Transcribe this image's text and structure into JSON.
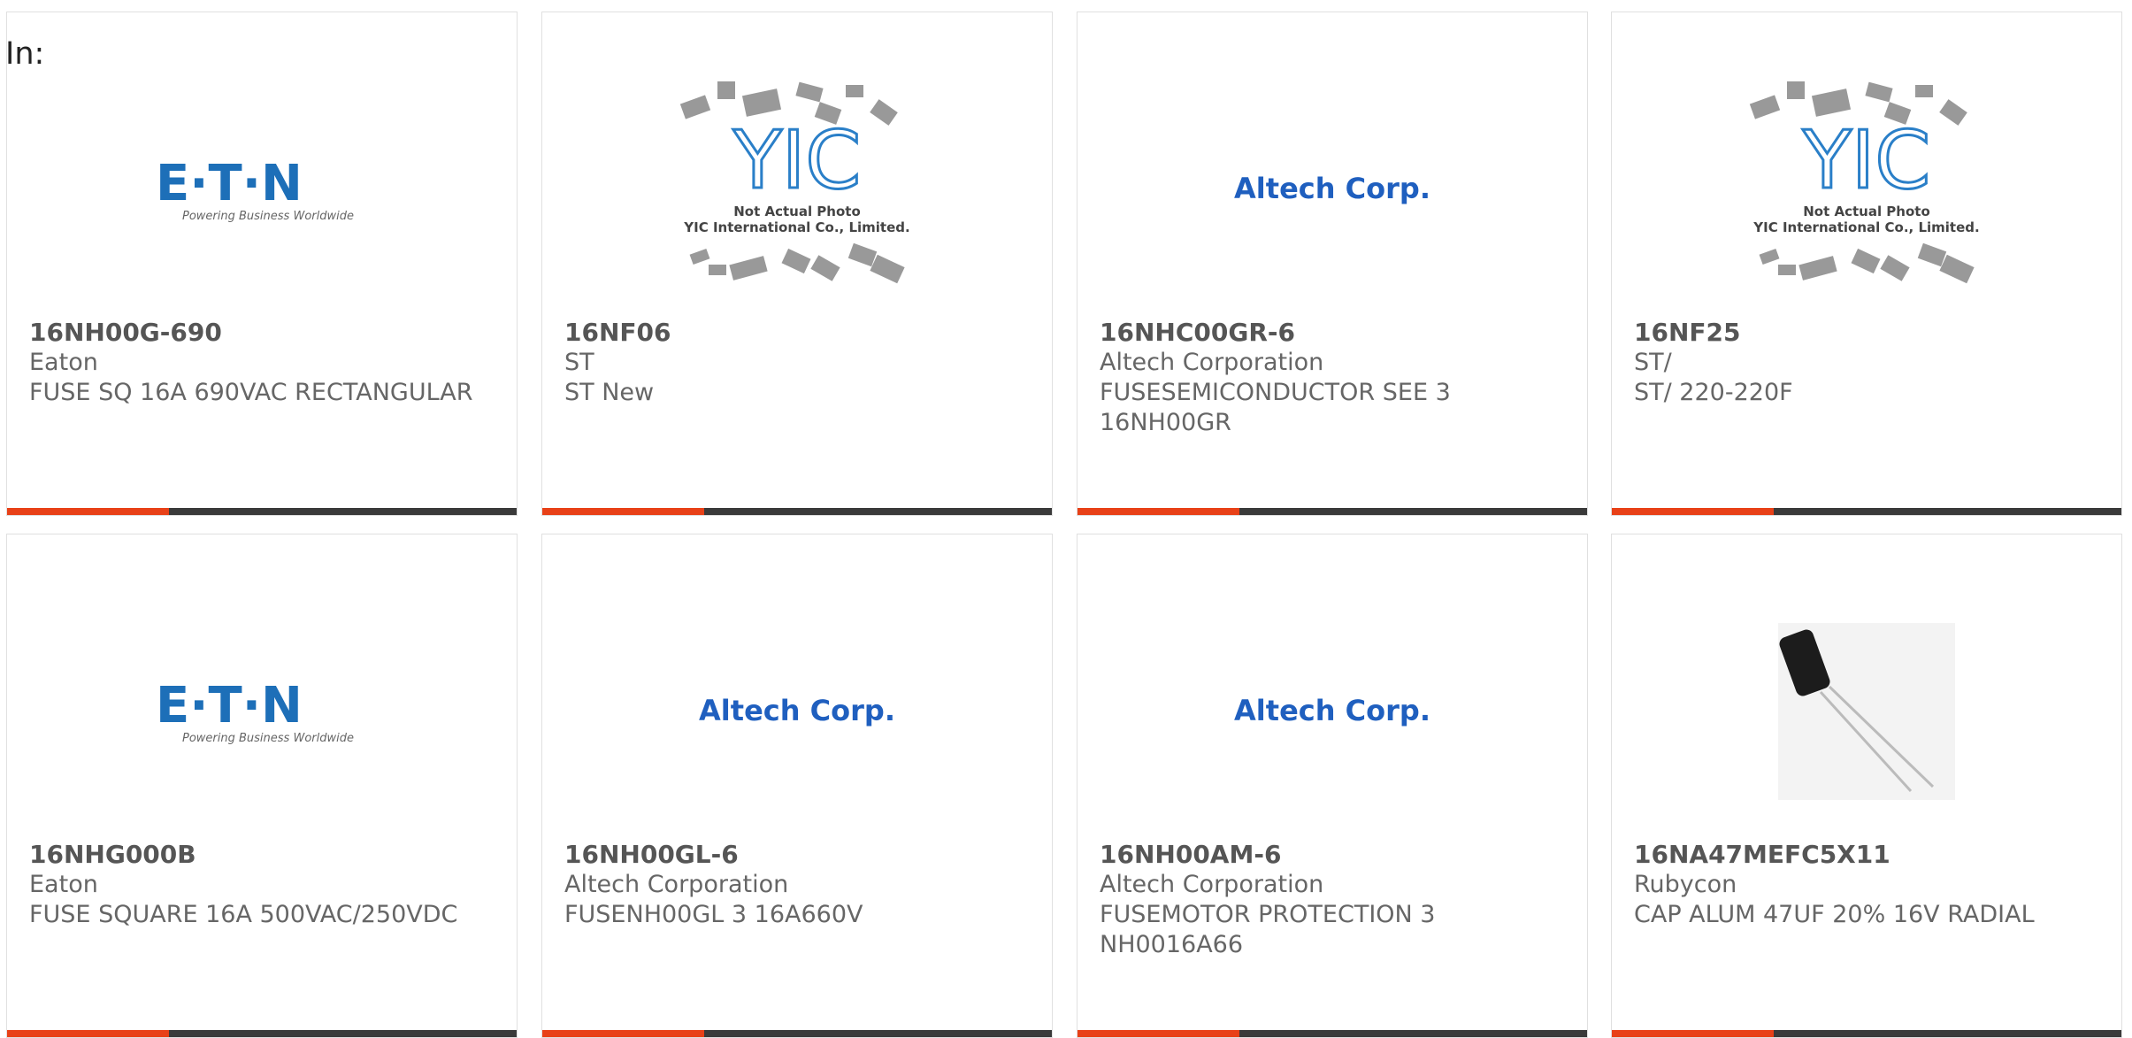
{
  "header": {
    "label": "In:"
  },
  "colors": {
    "accent": "#e84118",
    "bar": "#3a3a3a",
    "eaton_blue": "#1d6fb8",
    "altech_blue": "#1f5fbf"
  },
  "cards": [
    {
      "part": "16NH00G-690",
      "manufacturer": "Eaton",
      "description": "FUSE SQ 16A 690VAC RECTANGULAR",
      "image": "eaton-logo",
      "logo_text": "E·T·N",
      "logo_sub": "Powering Business Worldwide"
    },
    {
      "part": "16NF06",
      "manufacturer": "ST",
      "description": "ST New",
      "image": "yic-placeholder",
      "photo_line1": "Not Actual Photo",
      "photo_line2": "YIC International Co., Limited.",
      "logo_text": "YIC"
    },
    {
      "part": "16NHC00GR-6",
      "manufacturer": "Altech Corporation",
      "description": "FUSESEMICONDUCTOR SEE 3 16NH00GR",
      "image": "altech-logo",
      "logo_text": "Altech Corp."
    },
    {
      "part": "16NF25",
      "manufacturer": "ST/",
      "description": "ST/ 220-220F",
      "image": "yic-placeholder",
      "photo_line1": "Not Actual Photo",
      "photo_line2": "YIC International Co., Limited.",
      "logo_text": "YIC"
    },
    {
      "part": "16NHG000B",
      "manufacturer": "Eaton",
      "description": "FUSE SQUARE 16A 500VAC/250VDC",
      "image": "eaton-logo",
      "logo_text": "E·T·N",
      "logo_sub": "Powering Business Worldwide"
    },
    {
      "part": "16NH00GL-6",
      "manufacturer": "Altech Corporation",
      "description": "FUSENH00GL 3 16A660V",
      "image": "altech-logo",
      "logo_text": "Altech Corp."
    },
    {
      "part": "16NH00AM-6",
      "manufacturer": "Altech Corporation",
      "description": "FUSEMOTOR PROTECTION 3 NH0016A66",
      "image": "altech-logo",
      "logo_text": "Altech Corp."
    },
    {
      "part": "16NA47MEFC5X11",
      "manufacturer": "Rubycon",
      "description": "CAP ALUM 47UF 20% 16V RADIAL",
      "image": "capacitor-photo"
    }
  ]
}
